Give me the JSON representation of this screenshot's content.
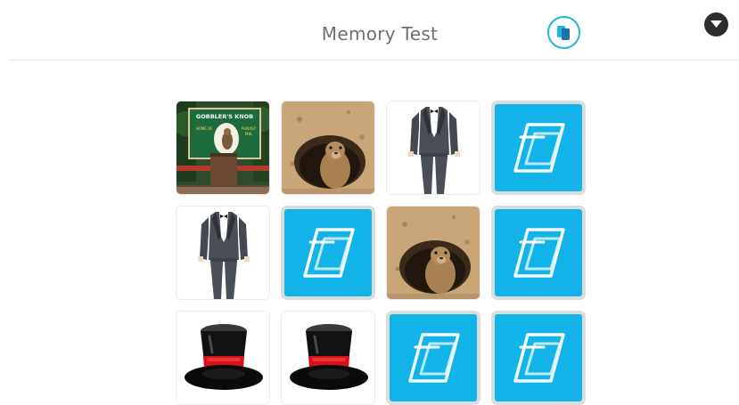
{
  "header": {
    "title": "Memory Test"
  },
  "board": {
    "rows": 3,
    "columns": 4,
    "cards": [
      {
        "state": "face-up",
        "image": "groundhog-day-stage-photo"
      },
      {
        "state": "face-up",
        "image": "groundhog-in-burrow-photo"
      },
      {
        "state": "face-up",
        "image": "tuxedo-suit-photo"
      },
      {
        "state": "face-down",
        "image": "nearpod-card-back"
      },
      {
        "state": "face-up",
        "image": "tuxedo-suit-photo"
      },
      {
        "state": "face-down",
        "image": "nearpod-card-back"
      },
      {
        "state": "face-up",
        "image": "groundhog-in-burrow-photo"
      },
      {
        "state": "face-down",
        "image": "nearpod-card-back"
      },
      {
        "state": "face-up",
        "image": "black-top-hat-red-band"
      },
      {
        "state": "face-up",
        "image": "black-top-hat-red-band"
      },
      {
        "state": "face-down",
        "image": "nearpod-card-back"
      },
      {
        "state": "face-down",
        "image": "nearpod-card-back"
      }
    ]
  },
  "sign_text": {
    "line1": "GOBBLER'S KNOB",
    "line2": "HOME OF PUNXSUTAWNEY PHIL"
  },
  "colors": {
    "accent": "#1fb6d8",
    "card_back": "#12b3e8",
    "card_border": "#dcdcdc",
    "title": "#6f6f6f"
  }
}
